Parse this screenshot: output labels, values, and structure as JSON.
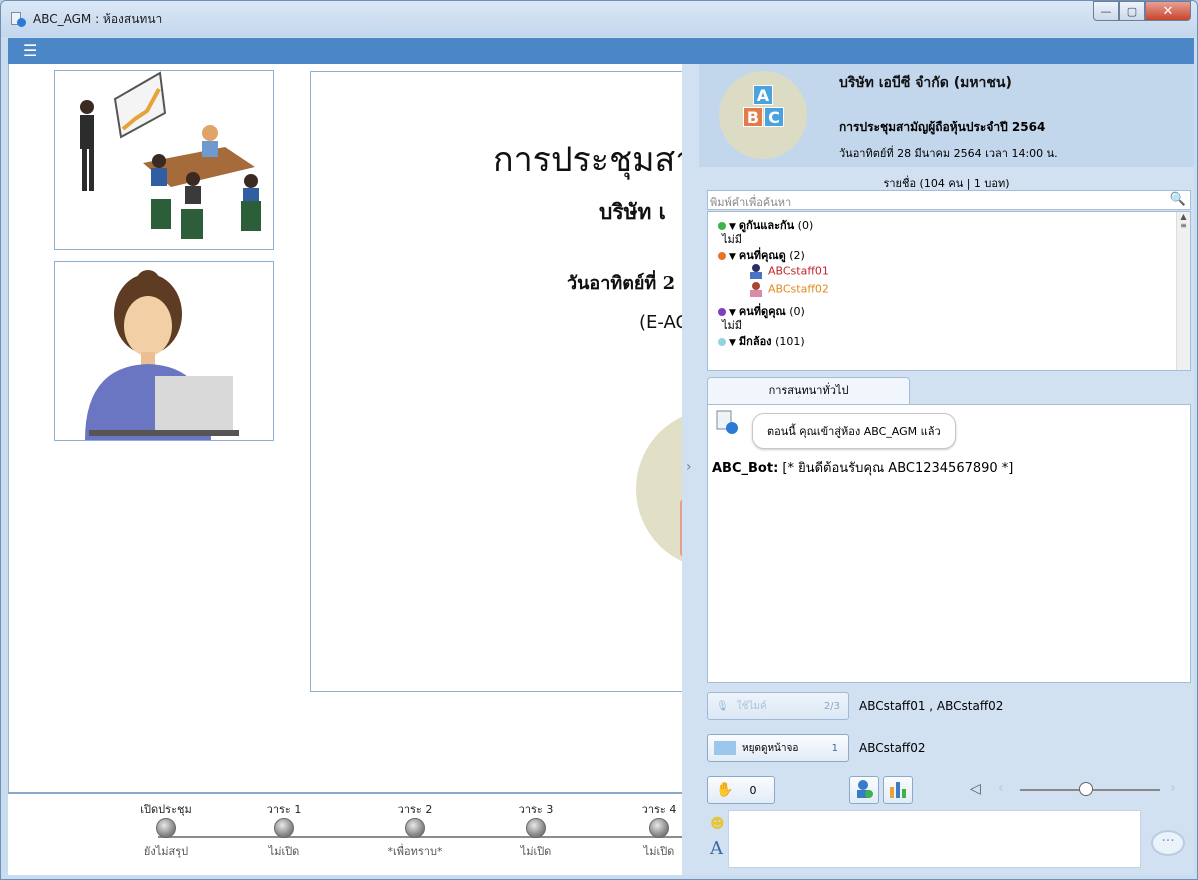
{
  "window": {
    "title": "ABC_AGM : ห้องสนทนา",
    "min": "—",
    "max": "▢",
    "close": "✕"
  },
  "slide": {
    "title": "การประชุมสามั",
    "line2": "บริษัท เ",
    "line3": "วันอาทิตย์ที่ 2",
    "line4": "(E-AC"
  },
  "timeline": [
    {
      "top": "เปิดประชุม",
      "bottom": "ยังไม่สรุป"
    },
    {
      "top": "วาระ 1",
      "bottom": "ไม่เปิด"
    },
    {
      "top": "วาระ 2",
      "bottom": "*เพื่อทราบ*"
    },
    {
      "top": "วาระ 3",
      "bottom": "ไม่เปิด"
    },
    {
      "top": "วาระ 4",
      "bottom": "ไม่เปิด"
    }
  ],
  "company": {
    "name": "บริษัท เอบีซี จำกัด (มหาชน)",
    "event": "การประชุมสามัญผู้ถือหุ้นประจำปี 2564",
    "date": "วันอาทิตย์ที่ 28 มีนาคม 2564 เวลา 14:00 น.",
    "logo_letters": [
      "A",
      "B",
      "C"
    ]
  },
  "roster": {
    "title": "รายชื่อ (104 คน | 1 บอท)",
    "search_placeholder": "พิมพ์คำเพื่อค้นหา",
    "groups": {
      "g1": {
        "name": "ดูกันและกัน",
        "count": "(0)",
        "empty": "ไม่มี"
      },
      "g2": {
        "name": "คนที่คุณดู",
        "count": "(2)",
        "members": [
          "ABCstaff01",
          "ABCstaff02"
        ]
      },
      "g3": {
        "name": "คนที่ดูคุณ",
        "count": "(0)",
        "empty": "ไม่มี"
      },
      "g4": {
        "name": "มีกล้อง",
        "count": "(101)"
      }
    }
  },
  "chat": {
    "tab": "การสนทนาทั่วไป",
    "system_msg": "ตอนนี้ คุณเข้าสู่ห้อง ABC_AGM แล้ว",
    "bot_name": "ABC_Bot:",
    "bot_msg": " [* ยินดีต้อนรับคุณ ABC1234567890 *]"
  },
  "controls": {
    "mic_label": "ใช้ไมค์",
    "mic_count": "2/3",
    "mic_users": "ABCstaff01 , ABCstaff02",
    "screen_label": "หยุดดูหน้าจอ",
    "screen_count": "1",
    "screen_users": "ABCstaff02",
    "hand_count": "0"
  },
  "colors": {
    "accent": "#4b86c6",
    "staff01": "#c0272d",
    "staff02": "#e08a1e"
  }
}
